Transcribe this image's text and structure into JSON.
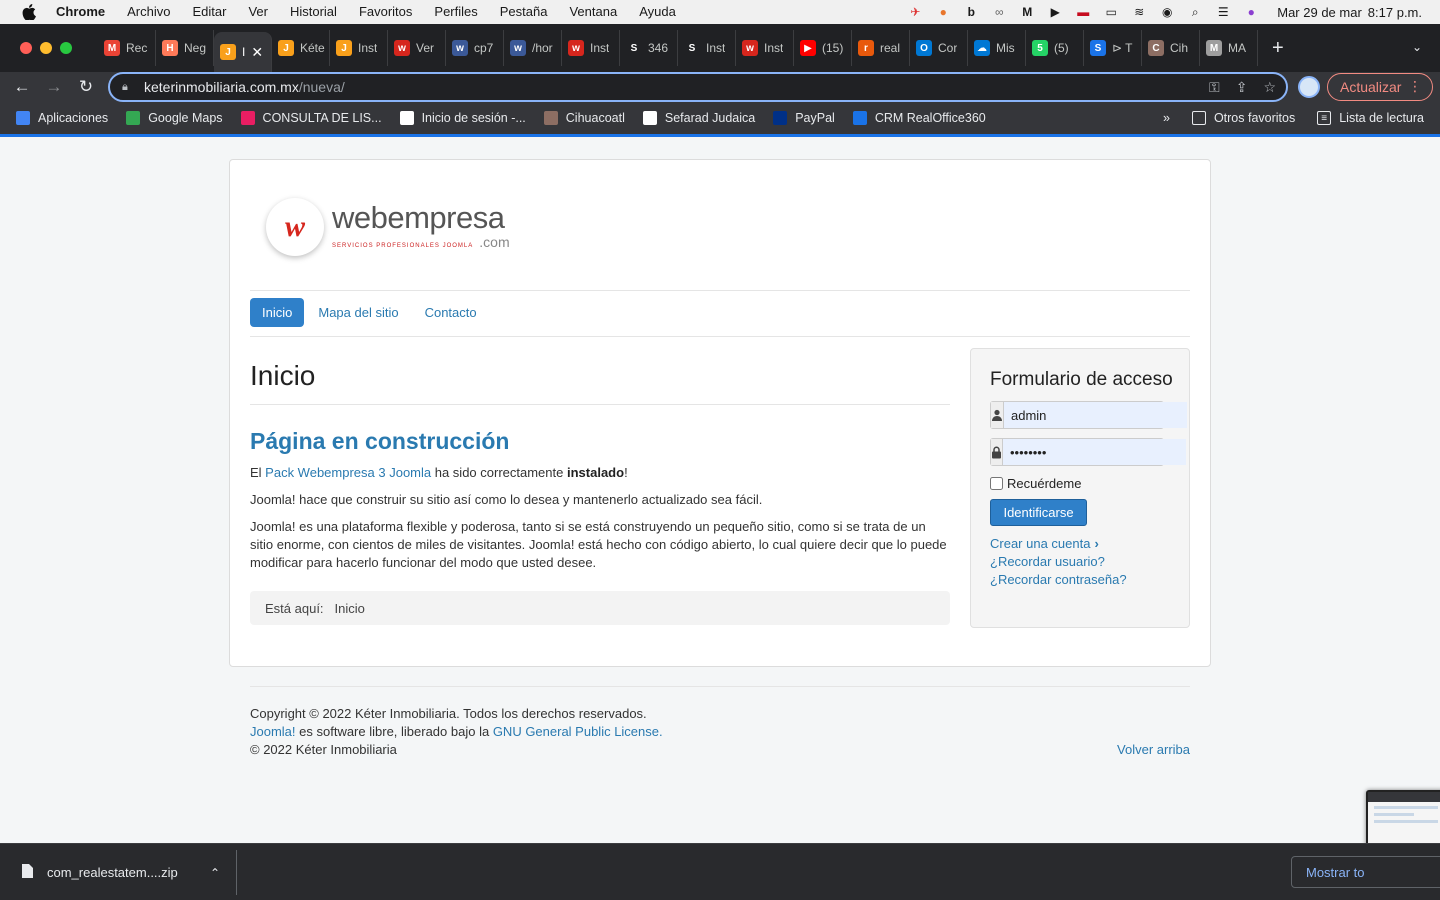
{
  "menubar": {
    "app": "Chrome",
    "items": [
      "Archivo",
      "Editar",
      "Ver",
      "Historial",
      "Favoritos",
      "Perfiles",
      "Pestaña",
      "Ventana",
      "Ayuda"
    ],
    "date": "Mar 29 de mar",
    "time": "8:17 p.m."
  },
  "tabs": [
    {
      "title": "Rec",
      "color": "#ea4335",
      "glyph": "M"
    },
    {
      "title": "Neg",
      "color": "#ff7a59",
      "glyph": "H"
    },
    {
      "title": "I",
      "color": "#f9a01b",
      "glyph": "J",
      "active": true
    },
    {
      "title": "Kéte",
      "color": "#f9a01b",
      "glyph": "J"
    },
    {
      "title": "Inst",
      "color": "#f9a01b",
      "glyph": "J"
    },
    {
      "title": "Ver",
      "color": "#d6261d",
      "glyph": "w"
    },
    {
      "title": "cp7",
      "color": "#3b5998",
      "glyph": "w"
    },
    {
      "title": "/hor",
      "color": "#3b5998",
      "glyph": "w"
    },
    {
      "title": "Inst",
      "color": "#d6261d",
      "glyph": "w"
    },
    {
      "title": "346",
      "color": "#202124",
      "glyph": "S"
    },
    {
      "title": "Inst",
      "color": "#202124",
      "glyph": "S"
    },
    {
      "title": "Inst",
      "color": "#d6261d",
      "glyph": "w"
    },
    {
      "title": "(15)",
      "color": "#ff0000",
      "glyph": "▶"
    },
    {
      "title": "real",
      "color": "#e8590c",
      "glyph": "r"
    },
    {
      "title": "Cor",
      "color": "#0078d4",
      "glyph": "O"
    },
    {
      "title": "Mis",
      "color": "#0078d4",
      "glyph": "☁"
    },
    {
      "title": "(5)",
      "color": "#25d366",
      "glyph": "5"
    },
    {
      "title": "⊳ T",
      "color": "#1a73e8",
      "glyph": "S"
    },
    {
      "title": "Cih",
      "color": "#8d6e63",
      "glyph": "C"
    },
    {
      "title": "MA",
      "color": "#9e9e9e",
      "glyph": "M"
    }
  ],
  "toolbar": {
    "url_host": "keterinmobiliaria.com.mx",
    "url_path": "/nueva/",
    "update_label": "Actualizar"
  },
  "bookmarks": [
    {
      "label": "Aplicaciones",
      "color": "#4285f4"
    },
    {
      "label": "Google Maps",
      "color": "#34a853"
    },
    {
      "label": "CONSULTA DE LIS...",
      "color": "#e91e63"
    },
    {
      "label": "Inicio de sesión -...",
      "color": "#ffffff"
    },
    {
      "label": "Cihuacoatl",
      "color": "#8d6e63"
    },
    {
      "label": "Sefarad Judaica",
      "color": "#ffffff"
    },
    {
      "label": "PayPal",
      "color": "#003087"
    },
    {
      "label": "CRM RealOffice360",
      "color": "#1a73e8"
    }
  ],
  "bookmarks_right": {
    "more": "»",
    "other": "Otros favoritos",
    "reading": "Lista de lectura"
  },
  "site": {
    "logo_brand": "webempresa",
    "logo_sub": "SERVICIOS PROFESIONALES JOOMLA",
    "logo_com": ".com",
    "nav": [
      "Inicio",
      "Mapa del sitio",
      "Contacto"
    ],
    "page_title": "Inicio",
    "article_title": "Página en construcción",
    "p1_pre": "El ",
    "p1_link": "Pack Webempresa 3 Joomla",
    "p1_mid": " ha sido correctamente ",
    "p1_bold": "instalado",
    "p1_end": "!",
    "p2": "Joomla! hace que construir su sitio así como lo desea y mantenerlo actualizado sea fácil.",
    "p3": "Joomla! es una plataforma flexible y poderosa, tanto si se está construyendo un pequeño sitio, como si se trata de un sitio enorme, con cientos de miles de visitantes. Joomla! está hecho con código abierto, lo cual quiere decir que lo puede modificar para hacerlo funcionar del modo que usted desee.",
    "breadcrumb_label": "Está aquí:",
    "breadcrumb_current": "Inicio"
  },
  "login": {
    "title": "Formulario de acceso",
    "username": "admin",
    "password": "••••••••",
    "remember": "Recuérdeme",
    "submit": "Identificarse",
    "create": "Crear una cuenta",
    "forgot_user": "¿Recordar usuario?",
    "forgot_pass": "¿Recordar contraseña?"
  },
  "footer": {
    "copyright": "Copyright © 2022 Kéter Inmobiliaria. Todos los derechos reservados.",
    "joomla_link": "Joomla!",
    "joomla_text": " es software libre, liberado bajo la ",
    "gpl_link": "GNU General Public License.",
    "owner": "© 2022 Kéter Inmobiliaria",
    "back_top": "Volver arriba"
  },
  "download": {
    "filename": "com_realestatem....zip",
    "show_all": "Mostrar to"
  }
}
